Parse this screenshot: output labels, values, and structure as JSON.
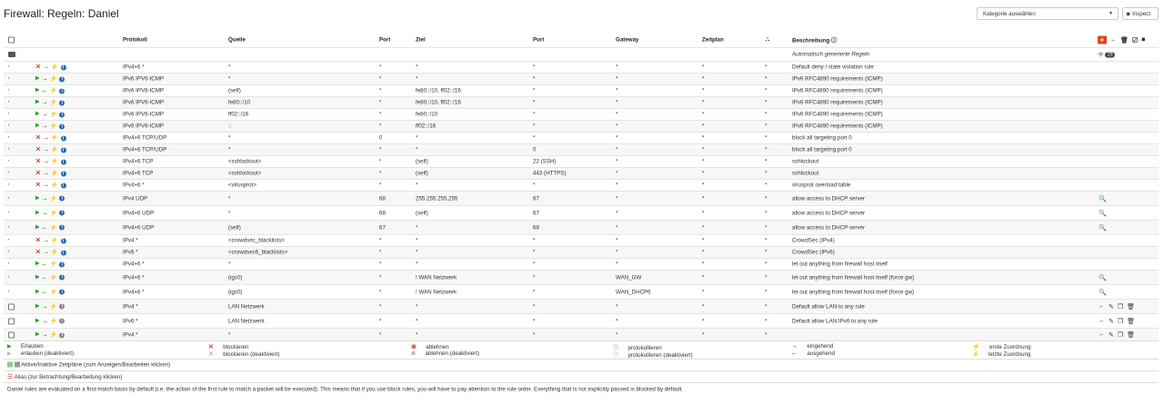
{
  "header": {
    "title": "Firewall: Regeln: Daniel",
    "category_select": "Kategorie auswählen",
    "inspect_label": "Inspect"
  },
  "table": {
    "columns": {
      "protocol": "Protokoll",
      "source": "Quelle",
      "port": "Port",
      "destination": "Ziel",
      "dest_port": "Port",
      "gateway": "Gateway",
      "schedule": "Zeitplan",
      "description": "Beschreibung"
    },
    "auto_rules_label": "Automatisch generierte Regeln",
    "auto_rules_count": "29",
    "rows": [
      {
        "action": "block",
        "dir": "in",
        "proto": "IPv4+6 *",
        "src": "*",
        "sport": "*",
        "dst": "*",
        "dport": "*",
        "gw": "*",
        "sched": "*",
        "desc": "Default deny / state violation rule",
        "tools": ""
      },
      {
        "action": "pass",
        "dir": "in",
        "proto": "IPv6 IPV6-ICMP",
        "src": "*",
        "sport": "*",
        "dst": "*",
        "dport": "*",
        "gw": "*",
        "sched": "*",
        "desc": "IPv6 RFC4890 requirements (ICMP)",
        "tools": ""
      },
      {
        "action": "pass",
        "dir": "out",
        "proto": "IPv6 IPV6-ICMP",
        "src": "(self)",
        "sport": "*",
        "dst": "fe80::/10, ff02::/16",
        "dport": "*",
        "gw": "*",
        "sched": "*",
        "desc": "IPv6 RFC4890 requirements (ICMP)",
        "tools": ""
      },
      {
        "action": "pass",
        "dir": "in",
        "proto": "IPv6 IPV6-ICMP",
        "src": "fe80::/10",
        "sport": "*",
        "dst": "fe80::/10, ff02::/16",
        "dport": "*",
        "gw": "*",
        "sched": "*",
        "desc": "IPv6 RFC4890 requirements (ICMP)",
        "tools": ""
      },
      {
        "action": "pass",
        "dir": "in",
        "proto": "IPv6 IPV6-ICMP",
        "src": "ff02::/16",
        "sport": "*",
        "dst": "fe80::/10",
        "dport": "*",
        "gw": "*",
        "sched": "*",
        "desc": "IPv6 RFC4890 requirements (ICMP)",
        "tools": ""
      },
      {
        "action": "pass",
        "dir": "in",
        "proto": "IPv6 IPV6-ICMP",
        "src": "::",
        "sport": "*",
        "dst": "ff02::/16",
        "dport": "*",
        "gw": "*",
        "sched": "*",
        "desc": "IPv6 RFC4890 requirements (ICMP)",
        "tools": ""
      },
      {
        "action": "block",
        "dir": "in",
        "proto": "IPv4+6 TCP/UDP",
        "src": "*",
        "sport": "0",
        "dst": "*",
        "dport": "*",
        "gw": "*",
        "sched": "*",
        "desc": "block all targeting port 0",
        "tools": ""
      },
      {
        "action": "block",
        "dir": "in",
        "proto": "IPv4+6 TCP/UDP",
        "src": "*",
        "sport": "*",
        "dst": "*",
        "dport": "0",
        "gw": "*",
        "sched": "*",
        "desc": "block all targeting port 0",
        "tools": ""
      },
      {
        "action": "block",
        "dir": "in",
        "proto": "IPv4+6 TCP",
        "src": "<sshlockout>",
        "sport": "*",
        "dst": "(self)",
        "dport": "22 (SSH)",
        "gw": "*",
        "sched": "*",
        "desc": "sshlockout",
        "tools": ""
      },
      {
        "action": "block",
        "dir": "in",
        "proto": "IPv4+6 TCP",
        "src": "<sshlockout>",
        "sport": "*",
        "dst": "(self)",
        "dport": "443 (HTTPS)",
        "gw": "*",
        "sched": "*",
        "desc": "sshlockout",
        "tools": ""
      },
      {
        "action": "block",
        "dir": "in",
        "proto": "IPv4+6 *",
        "src": "<virusprot>",
        "sport": "*",
        "dst": "*",
        "dport": "*",
        "gw": "*",
        "sched": "*",
        "desc": "virusprot overload table",
        "tools": ""
      },
      {
        "action": "pass",
        "dir": "in",
        "proto": "IPv4 UDP",
        "src": "*",
        "sport": "68",
        "dst": "255.255.255.255",
        "dport": "67",
        "gw": "*",
        "sched": "*",
        "desc": "allow access to DHCP server",
        "tools": "search"
      },
      {
        "action": "pass",
        "dir": "in",
        "proto": "IPv4+6 UDP",
        "src": "*",
        "sport": "68",
        "dst": "(self)",
        "dport": "67",
        "gw": "*",
        "sched": "*",
        "desc": "allow access to DHCP server",
        "tools": "search"
      },
      {
        "action": "pass",
        "dir": "out",
        "proto": "IPv4+6 UDP",
        "src": "(self)",
        "sport": "67",
        "dst": "*",
        "dport": "68",
        "gw": "*",
        "sched": "*",
        "desc": "allow access to DHCP server",
        "tools": "search"
      },
      {
        "action": "block",
        "dir": "in",
        "proto": "IPv4 *",
        "src": "<crowdsec_blacklists>",
        "sport": "*",
        "dst": "*",
        "dport": "*",
        "gw": "*",
        "sched": "*",
        "desc": "CrowdSec (IPv4)",
        "tools": ""
      },
      {
        "action": "block",
        "dir": "in",
        "proto": "IPv6 *",
        "src": "<crowdsec6_blacklists>",
        "sport": "*",
        "dst": "*",
        "dport": "*",
        "gw": "*",
        "sched": "*",
        "desc": "CrowdSec (IPv6)",
        "tools": ""
      },
      {
        "action": "pass",
        "dir": "out",
        "proto": "IPv4+6 *",
        "src": "*",
        "sport": "*",
        "dst": "*",
        "dport": "*",
        "gw": "*",
        "sched": "*",
        "desc": "let out anything from firewall host itself",
        "tools": ""
      },
      {
        "action": "pass",
        "dir": "out",
        "proto": "IPv4+6 *",
        "src": "(igc0)",
        "sport": "*",
        "dst": "! WAN Netzwerk",
        "dport": "*",
        "gw": "WAN_GW",
        "sched": "*",
        "desc": "let out anything from firewall host itself (force gw)",
        "tools": "search"
      },
      {
        "action": "pass",
        "dir": "out",
        "proto": "IPv4+6 *",
        "src": "(igc0)",
        "sport": "*",
        "dst": "! WAN Netzwerk",
        "dport": "*",
        "gw": "WAN_DHCP6",
        "sched": "*",
        "desc": "let out anything from firewall host itself (force gw)",
        "tools": "search"
      },
      {
        "action": "pass",
        "dir": "in",
        "proto": "IPv4 *",
        "src": "LAN Netzwerk",
        "sport": "*",
        "dst": "*",
        "dport": "*",
        "gw": "*",
        "sched": "*",
        "desc": "Default allow LAN to any rule",
        "tools": "edit"
      },
      {
        "action": "pass",
        "dir": "in",
        "proto": "IPv6 *",
        "src": "LAN Netzwerk",
        "sport": "*",
        "dst": "*",
        "dport": "*",
        "gw": "*",
        "sched": "*",
        "desc": "Default allow LAN IPv6 to any rule",
        "tools": "edit"
      },
      {
        "action": "pass",
        "dir": "in",
        "proto": "IPv4 *",
        "src": "*",
        "sport": "*",
        "dst": "*",
        "dport": "*",
        "gw": "*",
        "sched": "*",
        "desc": "",
        "tools": "edit"
      }
    ]
  },
  "legend": {
    "pass": "Erlauben",
    "pass_disabled": "erlauben (deaktiviert)",
    "block": "blockieren",
    "block_disabled": "blockieren (deaktiviert)",
    "reject": "ablehnen",
    "reject_disabled": "ablehnen (deaktiviert)",
    "log": "protokollieren",
    "log_disabled": "protokollieren (deaktiviert)",
    "in": "eingehend",
    "out": "ausgehend",
    "first_match": "erste Zuordnung",
    "last_match": "letzte Zuordnung",
    "schedules": "Aktive/Inaktive Zeitpläne (zum Anzeigen/Bearbeiten klicken)",
    "alias": "Alias (zur Betrachtung/Bearbeitung klicken)",
    "note": "Daniel rules are evaluated on a first-match basis by default (i.e. the action of the first rule to match a packet will be executed). This means that if you use block rules, you will have to pay attention to the rule order. Everything that is not explicitly passed is blocked by default."
  }
}
